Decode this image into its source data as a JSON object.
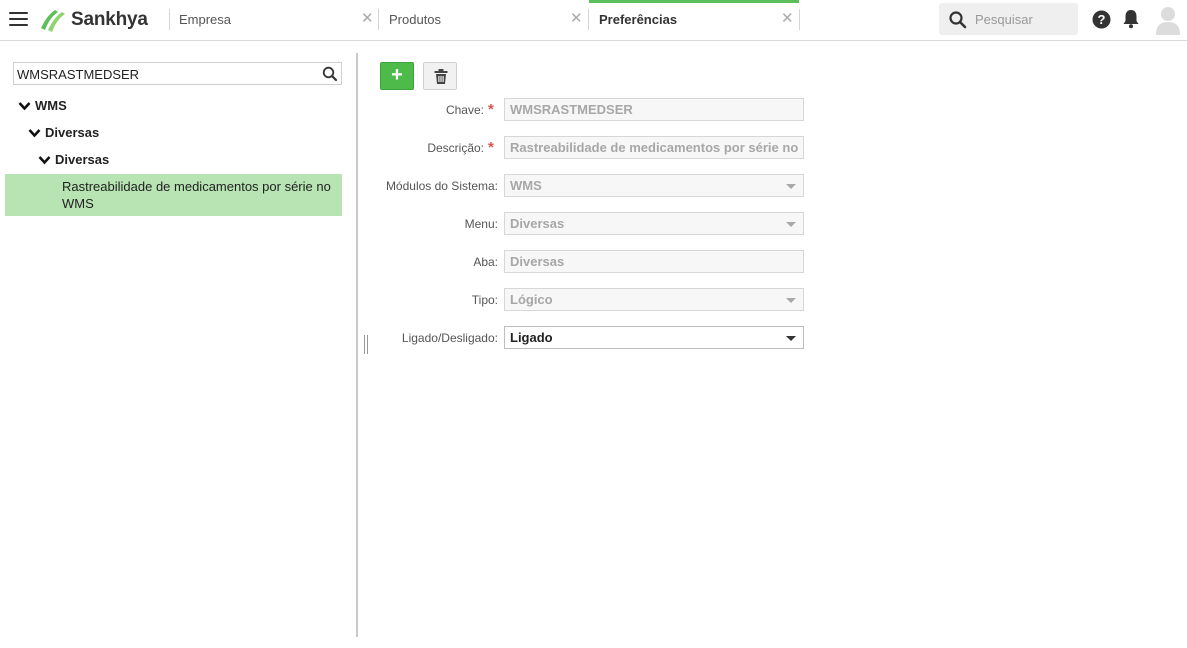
{
  "app": {
    "brand": "Sankhya",
    "accent_color": "#5dbf5a"
  },
  "header": {
    "tabs": [
      {
        "label": "Empresa",
        "active": false,
        "closable": false
      },
      {
        "label": "Produtos",
        "active": false,
        "closable": true
      },
      {
        "label": "Preferências",
        "active": true,
        "closable": true
      }
    ],
    "search": {
      "placeholder": "Pesquisar",
      "value": ""
    },
    "icons": [
      "menu-icon",
      "search-icon",
      "help-icon",
      "bell-icon",
      "user-avatar-icon"
    ]
  },
  "tree": {
    "search_value": "WMSRASTMEDSER",
    "nodes": [
      {
        "label": "WMS",
        "expanded": true
      },
      {
        "label": "Diversas",
        "expanded": true
      },
      {
        "label": "Diversas",
        "expanded": true
      }
    ],
    "selected_leaf": "Rastreabilidade de medicamentos por série no WMS"
  },
  "toolbar": {
    "add_label": "+"
  },
  "form": {
    "fields": [
      {
        "label": "Chave:",
        "value": "WMSRASTMEDSER",
        "required": true,
        "type": "text"
      },
      {
        "label": "Descrição:",
        "value": "Rastreabilidade de medicamentos por série no",
        "required": true,
        "type": "text"
      },
      {
        "label": "Módulos do Sistema:",
        "value": "WMS",
        "required": false,
        "type": "select"
      },
      {
        "label": "Menu:",
        "value": "Diversas",
        "required": false,
        "type": "select"
      },
      {
        "label": "Aba:",
        "value": "Diversas",
        "required": false,
        "type": "text"
      },
      {
        "label": "Tipo:",
        "value": "Lógico",
        "required": false,
        "type": "select"
      },
      {
        "label": "Ligado/Desligado:",
        "value": "Ligado",
        "required": false,
        "type": "select",
        "editable": true
      }
    ],
    "required_marker": "*"
  }
}
